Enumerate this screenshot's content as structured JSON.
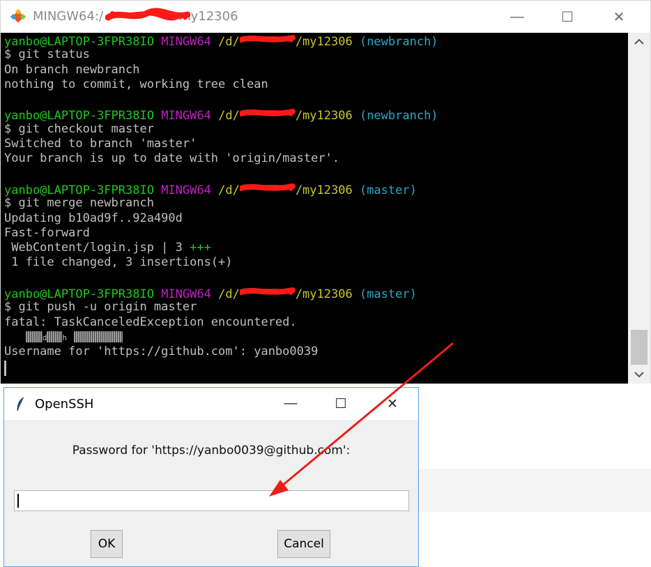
{
  "terminal": {
    "title_prefix": "MINGW64:/",
    "title_suffix": "my12306",
    "minimize": "—",
    "maximize": "☐",
    "close": "✕",
    "lines": [
      {
        "type": "prompt",
        "user": "yanbo@LAPTOP-3FPR38IO",
        "shell": "MINGW64",
        "path_prefix": "/d/",
        "path_suffix": "/my12306",
        "branch": "(newbranch)"
      },
      {
        "type": "text",
        "text": "$ git status"
      },
      {
        "type": "text",
        "text": "On branch newbranch"
      },
      {
        "type": "text",
        "text": "nothing to commit, working tree clean"
      },
      {
        "type": "blank"
      },
      {
        "type": "prompt",
        "user": "yanbo@LAPTOP-3FPR38IO",
        "shell": "MINGW64",
        "path_prefix": "/d/",
        "path_suffix": "/my12306",
        "branch": "(newbranch)"
      },
      {
        "type": "text",
        "text": "$ git checkout master"
      },
      {
        "type": "text",
        "text": "Switched to branch 'master'"
      },
      {
        "type": "text",
        "text": "Your branch is up to date with 'origin/master'."
      },
      {
        "type": "blank"
      },
      {
        "type": "prompt",
        "user": "yanbo@LAPTOP-3FPR38IO",
        "shell": "MINGW64",
        "path_prefix": "/d/",
        "path_suffix": "/my12306",
        "branch": "(master)"
      },
      {
        "type": "text",
        "text": "$ git merge newbranch"
      },
      {
        "type": "text",
        "text": "Updating b10ad9f..92a490d"
      },
      {
        "type": "text",
        "text": "Fast-forward"
      },
      {
        "type": "diffstat",
        "text": " WebContent/login.jsp | 3 ",
        "plus": "+++"
      },
      {
        "type": "text",
        "text": " 1 file changed, 3 insertions(+)"
      },
      {
        "type": "blank"
      },
      {
        "type": "prompt",
        "user": "yanbo@LAPTOP-3FPR38IO",
        "shell": "MINGW64",
        "path_prefix": "/d/",
        "path_suffix": "/my12306",
        "branch": "(master)"
      },
      {
        "type": "text",
        "text": "$ git push -u origin master"
      },
      {
        "type": "text",
        "text": "fatal: TaskCanceledException encountered."
      },
      {
        "type": "garbled",
        "mid": "d",
        "mid2": "h"
      },
      {
        "type": "text",
        "text": "Username for 'https://github.com': yanbo0039"
      }
    ]
  },
  "dialog": {
    "title": "OpenSSH",
    "minimize": "—",
    "maximize": "☐",
    "close": "✕",
    "prompt": "Password for 'https://yanbo0039@github.com':",
    "password_value": "",
    "ok_label": "OK",
    "cancel_label": "Cancel"
  },
  "colors": {
    "annotation_arrow": "#e8201a",
    "redaction": "#ff1a1a",
    "user_green": "#1ec81e",
    "shell_magenta": "#c020c0",
    "path_yellow": "#c8c82a",
    "branch_cyan": "#2aa9c8"
  },
  "icons": {
    "terminal_app": "git-diamond-icon",
    "dialog_app": "feather-icon",
    "scroll_up": "chevron-up-icon",
    "scroll_down": "chevron-down-icon"
  }
}
